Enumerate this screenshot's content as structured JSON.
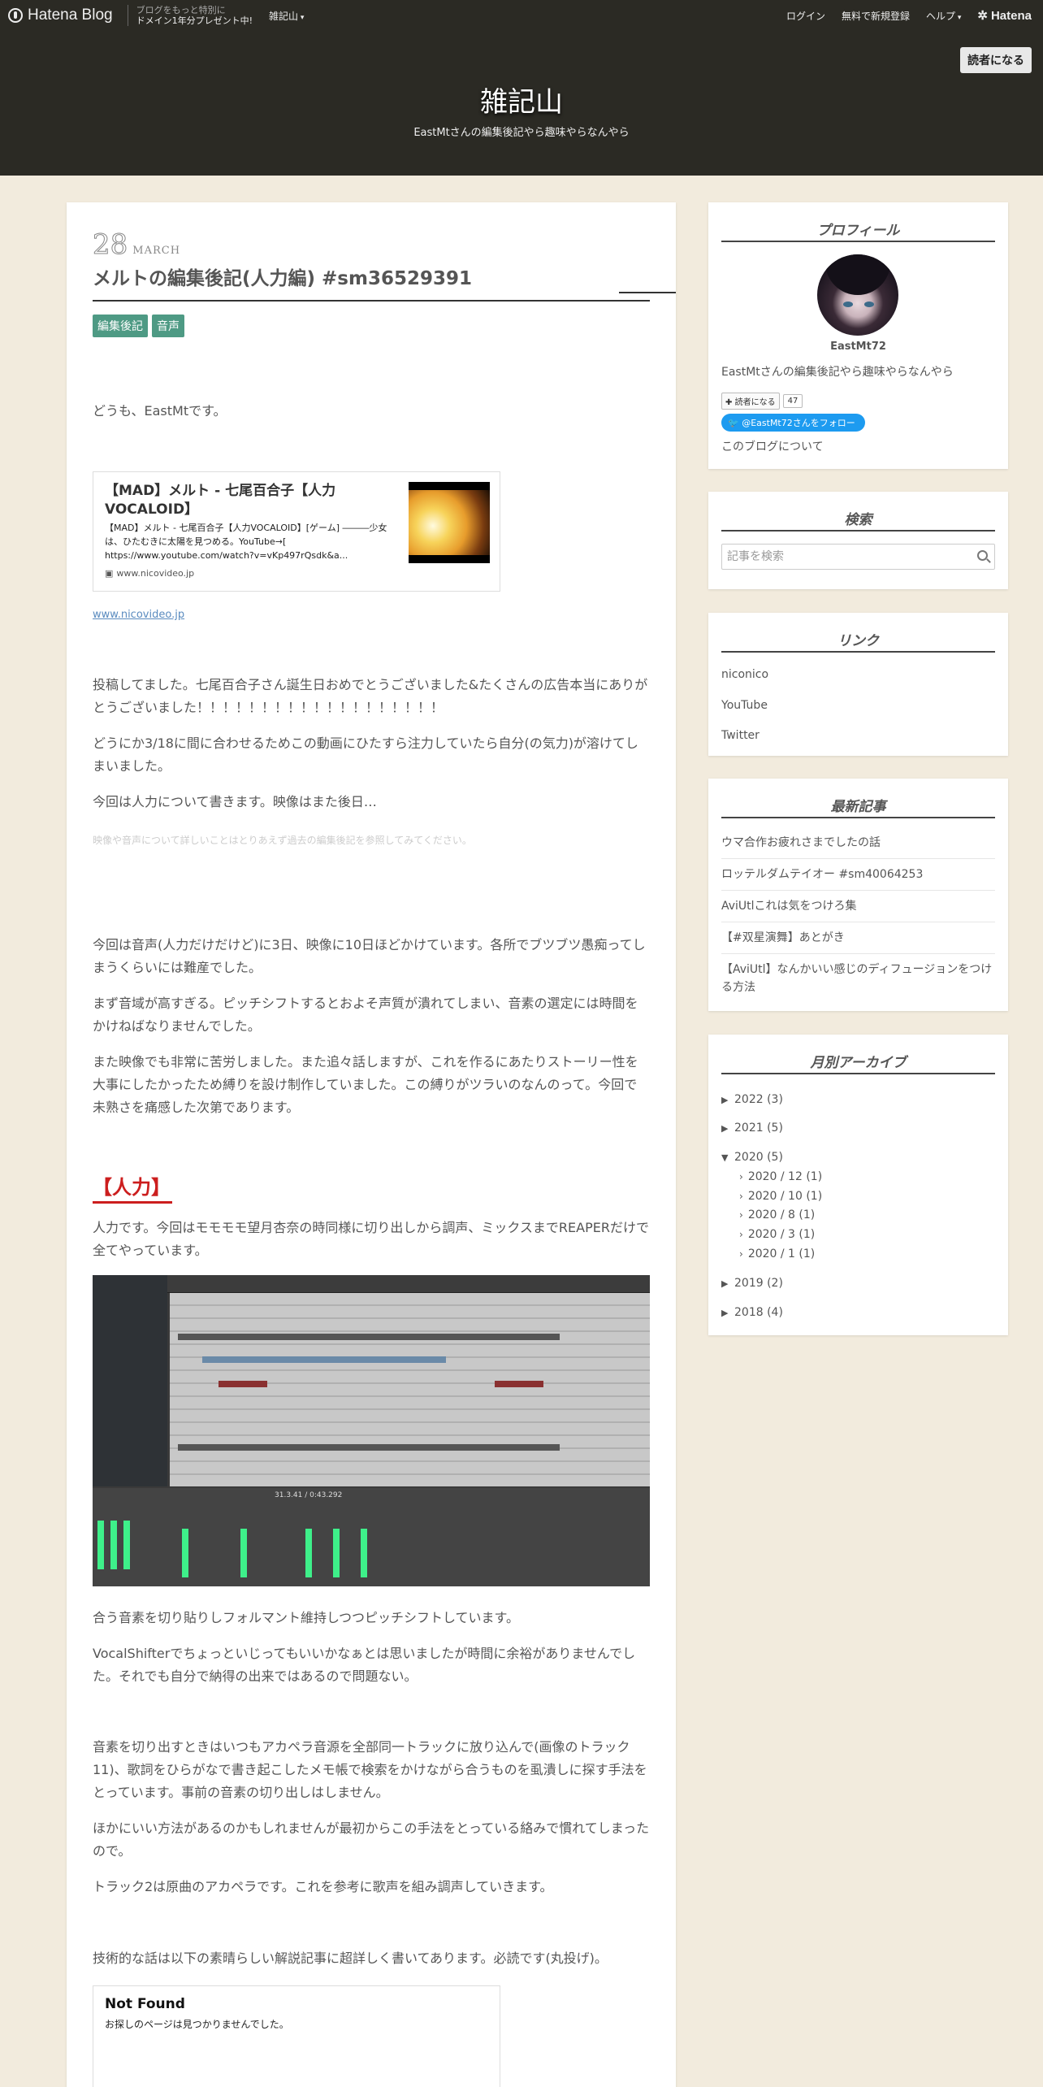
{
  "topbar": {
    "logo_text": "Hatena Blog",
    "promo_line1": "ブログをもっと特別に",
    "promo_line2": "ドメイン1年分プレゼント中!",
    "blog_selector": "雑記山",
    "login": "ログイン",
    "signup": "無料で新規登録",
    "help": "ヘルプ",
    "hatena": "Hatena"
  },
  "header": {
    "reader_button": "読者になる",
    "title": "雑記山",
    "description": "EastMtさんの編集後記やら趣味やらなんやら"
  },
  "entry": {
    "day": "28",
    "month": "MARCH",
    "title": "メルトの編集後記(人力編) #sm36529391",
    "tags": [
      "編集後記",
      "音声"
    ],
    "greeting": "どうも、EastMtです。",
    "embed1": {
      "title": "【MAD】メルト - 七尾百合子【人力VOCALOID】",
      "description": "【MAD】メルト - 七尾百合子【人力VOCALOID】[ゲーム] ―――少女は、ひたむきに太陽を見つめる。YouTube→[ https://www.youtube.com/watch?v=vKp497rQsdk&a...",
      "source": "www.nicovideo.jp"
    },
    "source_link": "www.nicovideo.jp",
    "p1": "投稿してました。七尾百合子さん誕生日おめでとうございました&たくさんの広告本当にありがとうございました！！！！！！！！！！！！！！！！！！！",
    "p2": "どうにか3/18に間に合わせるためこの動画にひたすら注力していたら自分(の気力)が溶けてしまいました。",
    "p3": "今回は人力について書きます。映像はまた後日…",
    "faint_note": "映像や音声について詳しいことはとりあえず過去の編集後記を参照してみてください。",
    "p4": "今回は音声(人力だけだけど)に3日、映像に10日ほどかけています。各所でブツブツ愚痴ってしまうくらいには難産でした。",
    "p5": "まず音域が高すぎる。ピッチシフトするとおよそ声質が潰れてしまい、音素の選定には時間をかけねばなりませんでした。",
    "p6": "また映像でも非常に苦労しました。また追々話しますが、これを作るにあたりストーリー性を大事にしたかったため縛りを設け制作していました。この縛りがツラいのなんのって。今回で未熟さを痛感した次第であります。",
    "heading1": "【人力】",
    "p7": "人力です。今回はモモモモ望月杏奈の時同様に切り出しから調声、ミックスまでREAPERだけで全てやっています。",
    "p8": "合う音素を切り貼りしフォルマント維持しつつピッチシフトしています。",
    "p9": "VocalShifterでちょっといじってもいいかなぁとは思いましたが時間に余裕がありませんでした。それでも自分で納得の出来ではあるので問題ない。",
    "p10": "音素を切り出すときはいつもアカペラ音源を全部同一トラックに放り込んで(画像のトラック11)、歌詞をひらがなで書き起こしたメモ帳で検索をかけながら合うものを虱潰しに探す手法をとっています。事前の音素の切り出しはしません。",
    "p11": "ほかにいい方法があるのかもしれませんが最初からこの手法をとっている絡みで慣れてしまったので。",
    "p12": "トラック2は原曲のアカペラです。これを参考に歌声を組み調声していきます。",
    "p13": "技術的な話は以下の素晴らしい解説記事に超詳しく書いてあります。必読です(丸投げ)。",
    "notfound": {
      "title": "Not Found",
      "description": "お探しのページは見つかりませんでした。"
    },
    "screenshot_time": "31.3.41 / 0:43.292"
  },
  "sidebar": {
    "profile": {
      "heading": "プロフィール",
      "name": "EastMt72",
      "description": "EastMtさんの編集後記やら趣味やらなんやら",
      "reader_button": "読者になる",
      "reader_count": "47",
      "follow_button": "@EastMt72さんをフォロー",
      "about_link": "このブログについて"
    },
    "search": {
      "heading": "検索",
      "placeholder": "記事を検索"
    },
    "links": {
      "heading": "リンク",
      "items": [
        "niconico",
        "YouTube",
        "Twitter"
      ]
    },
    "recent": {
      "heading": "最新記事",
      "items": [
        "ウマ合作お疲れさまでしたの話",
        "ロッテルダムテイオー #sm40064253",
        "AviUtlこれは気をつけろ集",
        "【#双星演舞】あとがき",
        "【AviUtl】なんかいい感じのディフュージョンをつける方法"
      ]
    },
    "archive": {
      "heading": "月別アーカイブ",
      "years": [
        {
          "label": "2022 (3)"
        },
        {
          "label": "2021 (5)"
        },
        {
          "label": "2020 (5)"
        },
        {
          "label": "2019 (2)"
        },
        {
          "label": "2018 (4)"
        }
      ],
      "months_2020": [
        "2020 / 12 (1)",
        "2020 / 10 (1)",
        "2020 / 8 (1)",
        "2020 / 3 (1)",
        "2020 / 1 (1)"
      ]
    }
  }
}
